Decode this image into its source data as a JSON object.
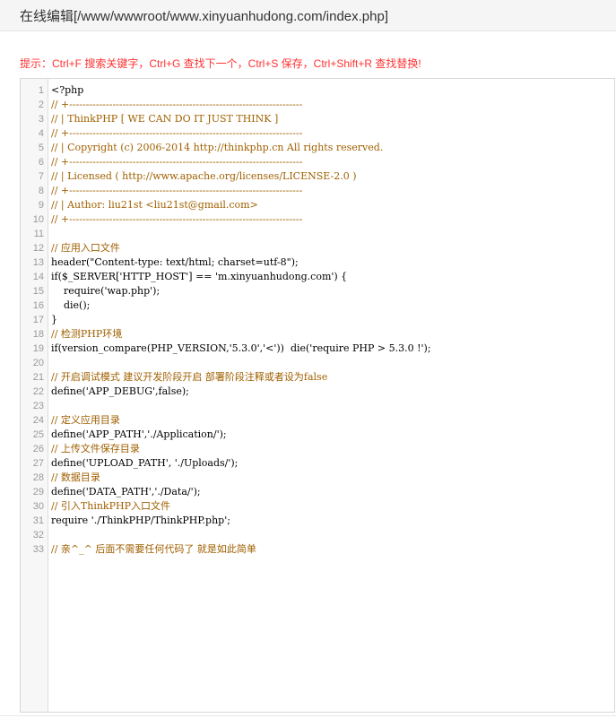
{
  "window": {
    "title": "在线编辑[/www/wwwroot/www.xinyuanhudong.com/index.php]"
  },
  "hint": "提示：Ctrl+F 搜索关键字，Ctrl+G 查找下一个，Ctrl+S 保存，Ctrl+Shift+R 查找替换!",
  "editor": {
    "lines": [
      "<?php",
      "// +----------------------------------------------------------------------",
      "// | ThinkPHP [ WE CAN DO IT JUST THINK ]",
      "// +----------------------------------------------------------------------",
      "// | Copyright (c) 2006-2014 http://thinkphp.cn All rights reserved.",
      "// +----------------------------------------------------------------------",
      "// | Licensed ( http://www.apache.org/licenses/LICENSE-2.0 )",
      "// +----------------------------------------------------------------------",
      "// | Author: liu21st <liu21st@gmail.com>",
      "// +----------------------------------------------------------------------",
      "",
      "// 应用入口文件",
      "header(\"Content-type: text/html; charset=utf-8\");",
      "if($_SERVER['HTTP_HOST'] == 'm.xinyuanhudong.com') {",
      "    require('wap.php');",
      "    die();",
      "}",
      "// 检测PHP环境",
      "if(version_compare(PHP_VERSION,'5.3.0','<'))  die('require PHP > 5.3.0 !');",
      "",
      "// 开启调试模式 建议开发阶段开启 部署阶段注释或者设为false",
      "define('APP_DEBUG',false);",
      "",
      "// 定义应用目录",
      "define('APP_PATH','./Application/');",
      "// 上传文件保存目录",
      "define('UPLOAD_PATH', './Uploads/');",
      "// 数据目录",
      "define('DATA_PATH','./Data/');",
      "// 引入ThinkPHP入口文件",
      "require './ThinkPHP/ThinkPHP.php';",
      "",
      "// 亲^_^ 后面不需要任何代码了 就是如此简单"
    ],
    "line_numbers": [
      "1",
      "2",
      "3",
      "4",
      "5",
      "6",
      "7",
      "8",
      "9",
      "10",
      "11",
      "12",
      "13",
      "14",
      "15",
      "16",
      "17",
      "18",
      "19",
      "20",
      "21",
      "22",
      "23",
      "24",
      "25",
      "26",
      "27",
      "28",
      "29",
      "30",
      "31",
      "32",
      "33"
    ],
    "colors": {
      "comment": "#a06000",
      "keyword": "#0000cc",
      "string": "#aa1111",
      "hint": "#ff3333"
    }
  }
}
